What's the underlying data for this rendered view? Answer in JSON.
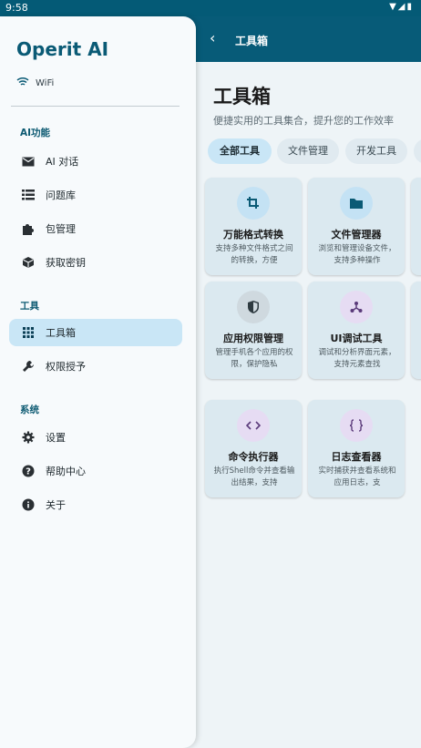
{
  "status": {
    "time": "9:58"
  },
  "topbar": {
    "title": "工具箱"
  },
  "main": {
    "title": "工具箱",
    "subtitle": "便捷实用的工具集合，提升您的工作效率",
    "chips": [
      "全部工具",
      "文件管理",
      "开发工具"
    ],
    "cards": [
      {
        "name": "万能格式转换",
        "desc": "支持多种文件格式之间的转换，方便",
        "icon": "crop-icon"
      },
      {
        "name": "文件管理器",
        "desc": "浏览和管理设备文件，支持多种操作",
        "icon": "folder-icon"
      },
      {
        "name": "应用权限管理",
        "desc": "管理手机各个应用的权限，保护隐私",
        "icon": "shield-icon"
      },
      {
        "name": "UI调试工具",
        "desc": "调试和分析界面元素，支持元素查找",
        "icon": "hierarchy-icon"
      },
      {
        "name": "命令执行器",
        "desc": "执行Shell命令并查看输出结果，支持",
        "icon": "code-icon"
      },
      {
        "name": "日志查看器",
        "desc": "实时捕获并查看系统和应用日志，支",
        "icon": "braces-icon"
      }
    ]
  },
  "drawer": {
    "app_name": "Operit AI",
    "network": "WiFi",
    "sections": {
      "ai": "AI功能",
      "tools": "工具",
      "system": "系统"
    },
    "items": [
      {
        "label": "AI 对话",
        "icon": "mail-icon"
      },
      {
        "label": "问题库",
        "icon": "list-icon"
      },
      {
        "label": "包管理",
        "icon": "puzzle-icon"
      },
      {
        "label": "获取密钥",
        "icon": "cube-icon"
      },
      {
        "label": "工具箱",
        "icon": "grid-icon"
      },
      {
        "label": "权限授予",
        "icon": "wrench-icon"
      },
      {
        "label": "设置",
        "icon": "gear-icon"
      },
      {
        "label": "帮助中心",
        "icon": "help-icon"
      },
      {
        "label": "关于",
        "icon": "info-icon"
      }
    ]
  }
}
